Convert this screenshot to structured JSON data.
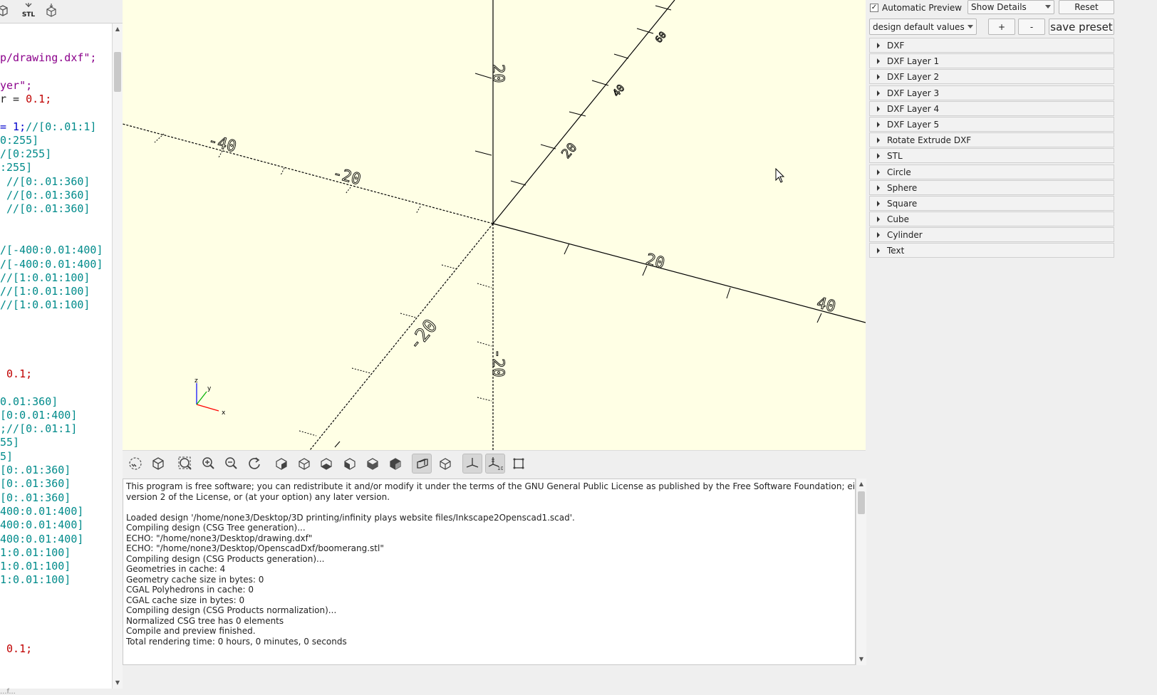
{
  "editor_toolbar": {
    "icons": [
      "cube-open-icon",
      "export-stl-icon",
      "send-to-printer-icon"
    ],
    "stl_label": "STL"
  },
  "editor": {
    "lines": [
      {
        "text": "p/drawing.dxf\";",
        "color": "purple",
        "row": 0
      },
      {
        "text": "yer\";",
        "color": "purple",
        "row": 2
      },
      {
        "text": "r = ",
        "color": "dark",
        "row": 3,
        "extra": "0.1;",
        "extra_color": "red"
      },
      {
        "text": "= 1;",
        "color": "blue",
        "row": 5,
        "extra": "//[0:.01:1]",
        "extra_color": "teal"
      },
      {
        "text": "0:255]",
        "color": "teal",
        "row": 6
      },
      {
        "text": "/[0:255]",
        "color": "teal",
        "row": 7
      },
      {
        "text": ":255]",
        "color": "teal",
        "row": 8
      },
      {
        "text": " //[0:.01:360]",
        "color": "teal",
        "row": 9
      },
      {
        "text": " //[0:.01:360]",
        "color": "teal",
        "row": 10
      },
      {
        "text": " //[0:.01:360]",
        "color": "teal",
        "row": 11
      },
      {
        "text": "/[-400:0.01:400]",
        "color": "teal",
        "row": 14
      },
      {
        "text": "/[-400:0.01:400]",
        "color": "teal",
        "row": 15
      },
      {
        "text": "//[1:0.01:100]",
        "color": "teal",
        "row": 16
      },
      {
        "text": "//[1:0.01:100]",
        "color": "teal",
        "row": 17
      },
      {
        "text": "//[1:0.01:100]",
        "color": "teal",
        "row": 18
      },
      {
        "text": " 0.1;",
        "color": "red",
        "row": 23
      },
      {
        "text": "0.01:360]",
        "color": "teal",
        "row": 25
      },
      {
        "text": "[0:0.01:400]",
        "color": "teal",
        "row": 26
      },
      {
        "text": ";//[0:.01:1]",
        "color": "teal",
        "row": 27
      },
      {
        "text": "55]",
        "color": "teal",
        "row": 28
      },
      {
        "text": "5]",
        "color": "teal",
        "row": 29
      },
      {
        "text": "[0:.01:360]",
        "color": "teal",
        "row": 30
      },
      {
        "text": "[0:.01:360]",
        "color": "teal",
        "row": 31
      },
      {
        "text": "[0:.01:360]",
        "color": "teal",
        "row": 32
      },
      {
        "text": "400:0.01:400]",
        "color": "teal",
        "row": 33
      },
      {
        "text": "400:0.01:400]",
        "color": "teal",
        "row": 34
      },
      {
        "text": "400:0.01:400]",
        "color": "teal",
        "row": 35
      },
      {
        "text": "1:0.01:100]",
        "color": "teal",
        "row": 36
      },
      {
        "text": "1:0.01:100]",
        "color": "teal",
        "row": 37
      },
      {
        "text": "1:0.01:100]",
        "color": "teal",
        "row": 38
      },
      {
        "text": " 0.1;",
        "color": "red",
        "row": 43
      }
    ]
  },
  "status_bar": {
    "text": "...f..."
  },
  "viewport": {
    "background": "#ffffe5",
    "axis_labels": {
      "x_pos": [
        "20",
        "40"
      ],
      "x_neg": [
        "-20",
        "-40"
      ],
      "y_pos": [
        "20",
        "40",
        "60"
      ],
      "y_neg": [
        "-20"
      ],
      "z_pos": [
        "20"
      ],
      "z_neg": [
        "-20"
      ]
    },
    "gizmo": {
      "x": "x",
      "y": "y",
      "z": "z"
    }
  },
  "view_toolbar": {
    "buttons": [
      "preview-icon",
      "render-icon",
      "view-all-icon",
      "zoom-in-icon",
      "zoom-out-icon",
      "reset-view-icon",
      "view-right-icon",
      "view-top-icon",
      "view-bottom-icon",
      "view-left-icon",
      "view-front-icon",
      "view-back-icon",
      "perspective-icon",
      "orthogonal-icon",
      "show-axes-icon",
      "show-scale-markers-icon",
      "show-edges-icon"
    ]
  },
  "console": {
    "lines": [
      "This program is free software; you can redistribute it and/or modify it under the terms of the GNU General Public License as published by the Free Software Foundation; either",
      "version 2 of the License, or (at your option) any later version.",
      "",
      "Loaded design '/home/none3/Desktop/3D printing/infinity plays website files/Inkscape2Openscad1.scad'.",
      "Compiling design (CSG Tree generation)...",
      "ECHO: \"/home/none3/Desktop/drawing.dxf\"",
      "ECHO: \"/home/none3/Desktop/OpenscadDxf/boomerang.stl\"",
      "Compiling design (CSG Products generation)...",
      "Geometries in cache: 4",
      "Geometry cache size in bytes: 0",
      "CGAL Polyhedrons in cache: 0",
      "CGAL cache size in bytes: 0",
      "Compiling design (CSG Products normalization)...",
      "Normalized CSG tree has 0 elements",
      "Compile and preview finished.",
      "Total rendering time: 0 hours, 0 minutes, 0 seconds"
    ]
  },
  "customizer": {
    "automatic_preview": {
      "label": "Automatic Preview",
      "checked": "✓"
    },
    "details_select": "Show Details",
    "reset_button": "Reset",
    "preset_select": "design default values",
    "plus_button": "+",
    "minus_button": "-",
    "save_preset_button": "save preset",
    "groups": [
      "DXF",
      "DXF Layer 1",
      "DXF Layer 2",
      "DXF Layer 3",
      "DXF Layer 4",
      "DXF Layer 5",
      "Rotate Extrude DXF",
      "STL",
      "Circle",
      "Sphere",
      "Square",
      "Cube",
      "Cylinder",
      "Text"
    ]
  }
}
